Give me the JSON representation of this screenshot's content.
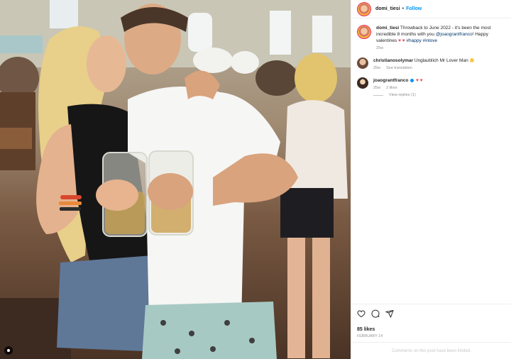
{
  "post": {
    "username": "domi_tiesi",
    "separator": "•",
    "follow_label": "Follow"
  },
  "caption": {
    "username": "domi_tiesi",
    "text_part1": "Throwback to June 2022 - it's been the most incredible 8 months with you ",
    "mention": "@joaograntfranco",
    "text_part2": "! Happy valentines ",
    "hearts": "♥ ♥",
    "hashtags": "#happy #inlove",
    "time": "25w"
  },
  "comments": [
    {
      "username": "christianosolymar",
      "text": "Unglaublich Mr Lover Man",
      "time": "25w",
      "action": "See translation",
      "emoji": "clapping-hands-icon"
    },
    {
      "username": "joaograntfranco",
      "hearts": "♥ ♥",
      "time": "25w",
      "likes": "2 likes",
      "replies": "View replies (1)"
    }
  ],
  "actions": {
    "icons": [
      "heart-icon",
      "comment-icon",
      "share-icon"
    ],
    "likes": "85 likes",
    "date": "FEBRUARY 14"
  },
  "footer": {
    "text": "Comments on this post have been limited."
  },
  "colors": {
    "accent": "#0095f6",
    "heart": "#ed4956",
    "muted": "#8e8e8e",
    "text": "#262626"
  }
}
